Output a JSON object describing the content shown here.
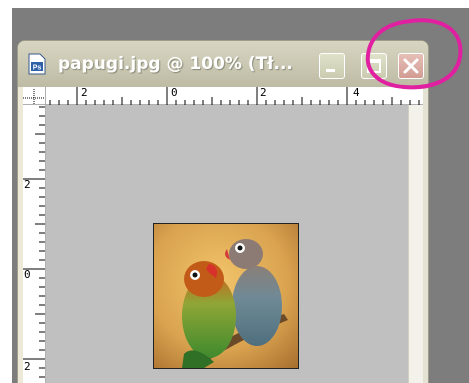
{
  "window": {
    "title": "papugi.jpg @ 100% (Tł...",
    "app_icon_text": "Ps"
  },
  "rulers": {
    "top_labels": [
      "2",
      "0",
      "2",
      "4"
    ],
    "left_labels": [
      "2",
      "0",
      "2"
    ]
  },
  "photo": {
    "subject": "two lovebird parrots on a branch"
  },
  "colors": {
    "background": "#7d7d7d",
    "window_frame": "#ece9d8",
    "canvas": "#c0c0c0",
    "close_button": "#d29d93",
    "annotation": "#e020a0"
  }
}
